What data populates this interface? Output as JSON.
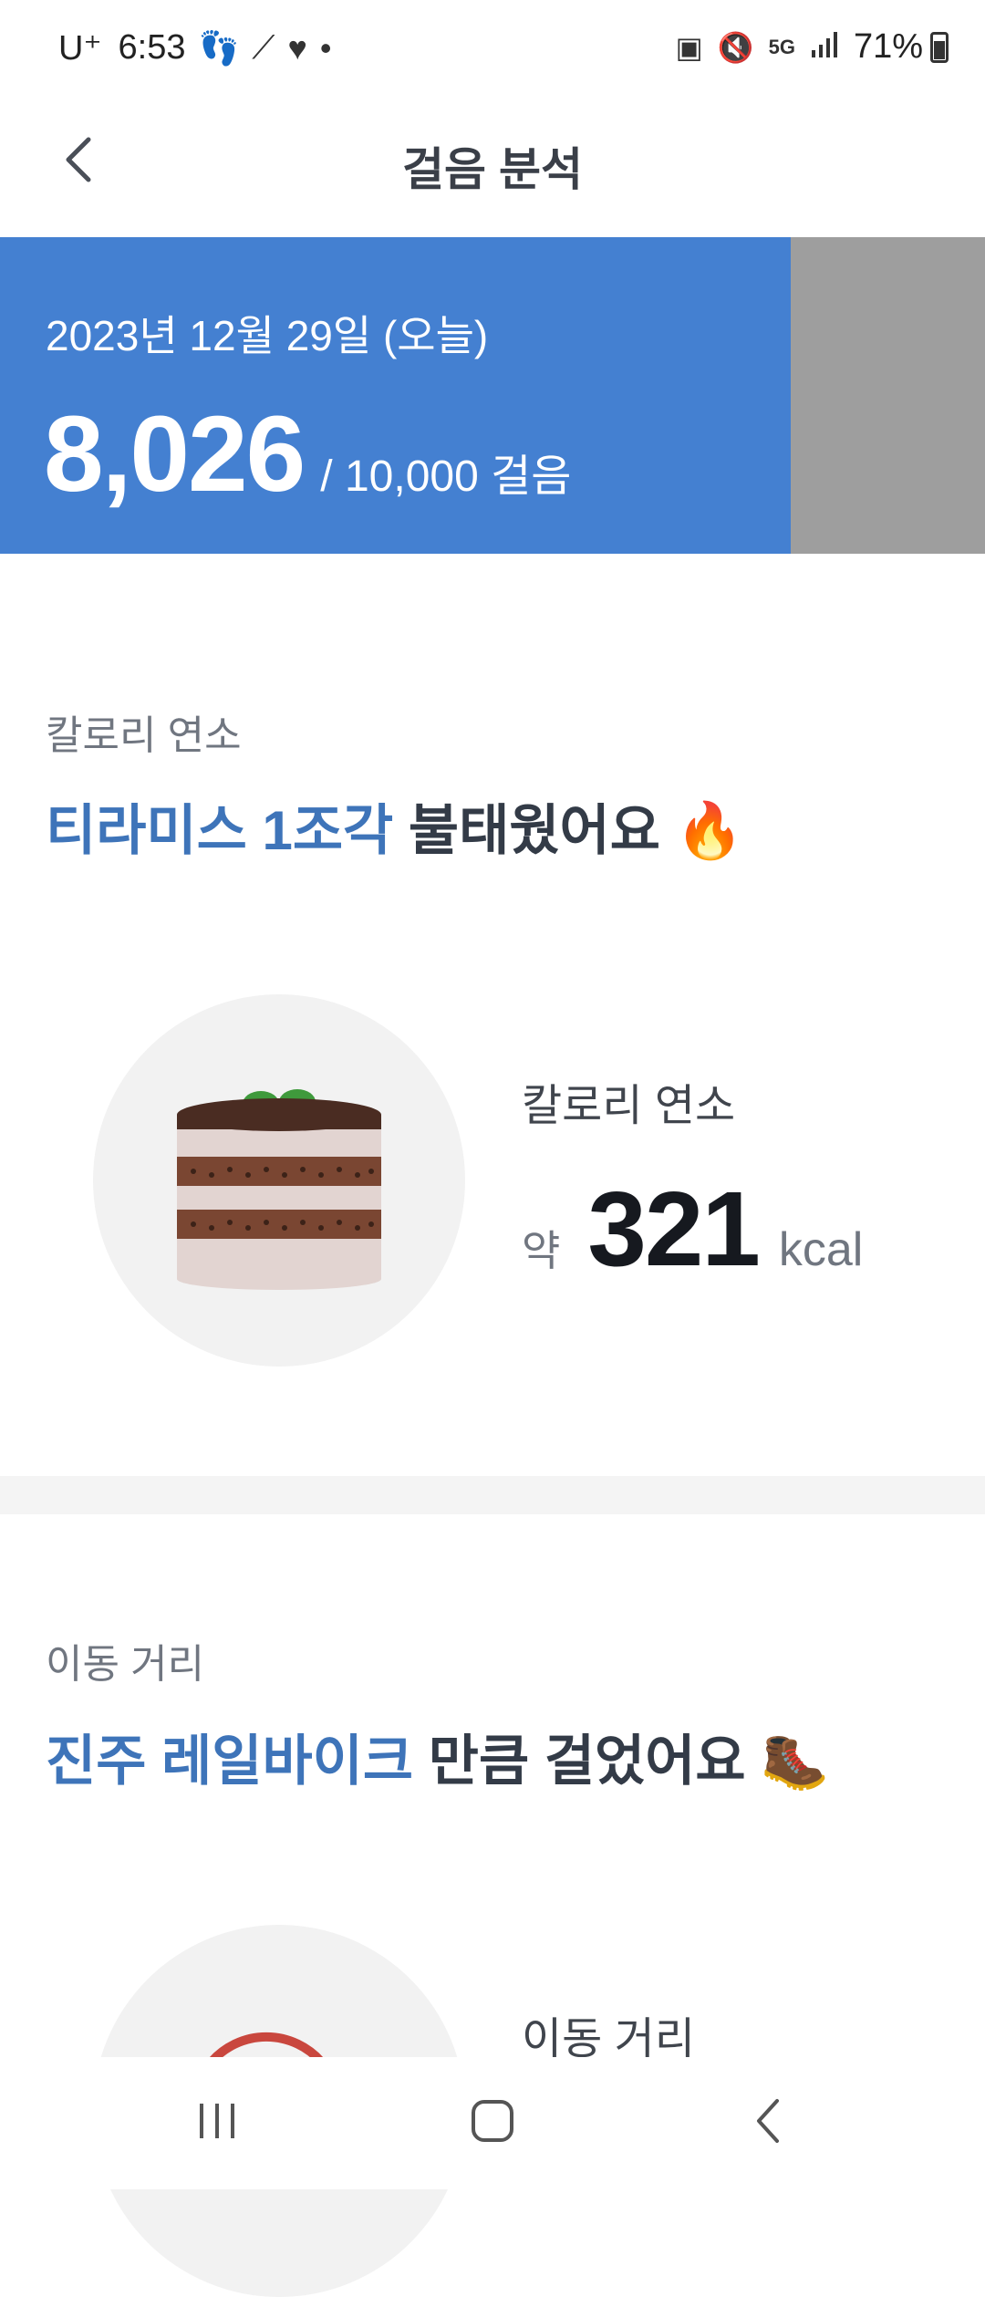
{
  "status_bar": {
    "carrier": "U⁺",
    "time": "6:53",
    "signal_label": "5G",
    "battery": "71%"
  },
  "header": {
    "title": "걸음 분석"
  },
  "steps": {
    "date": "2023년 12월 29일 (오늘)",
    "current": "8,026",
    "goal": "/ 10,000 걸음",
    "progress_fraction": 0.8026,
    "fill_color": "#4480d1"
  },
  "calories": {
    "section_label": "칼로리 연소",
    "headline_highlight": "티라미스 1조각",
    "headline_rest": " 불태웠어요 🔥",
    "stat_label": "칼로리 연소",
    "prefix": "약",
    "value": "321",
    "unit": "kcal",
    "illustration": "tiramisu-cake-icon"
  },
  "distance": {
    "section_label": "이동 거리",
    "headline_highlight": "진주 레일바이크",
    "headline_rest": " 만큼 걸었어요 🥾",
    "stat_label": "이동 거리"
  },
  "colors": {
    "accent": "#3e74b9",
    "banner": "#4480d1",
    "banner_remaining": "#9e9e9e"
  }
}
